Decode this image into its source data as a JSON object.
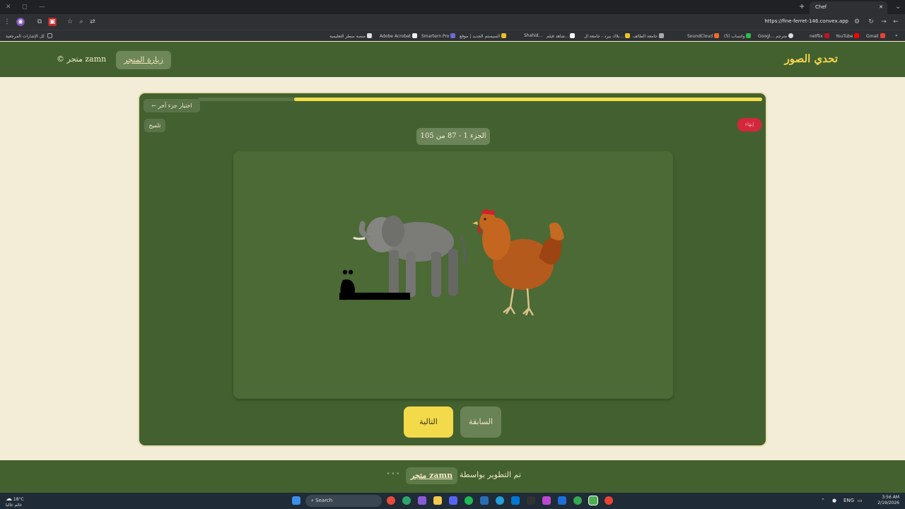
{
  "browser": {
    "tab_title": "Chef",
    "url": "https://fine-ferret-146.convex.app",
    "bookmarks_all": "كل الإشارات المرجعية",
    "bookmarks": [
      "منصة سطر التعليمية",
      "Adobe Acrobat",
      "Smartern Pro",
      "السيستم الجديد | موقع",
      "Shahid...",
      "شاهد فيلم...",
      "بلاك بيرد - جامعة ال...",
      "جامعة الطائف",
      "SoundCloud",
      "(5) واتساب",
      "Googl... مترجم",
      "netflix",
      "YouTube",
      "Gmail"
    ]
  },
  "header": {
    "brand": "تحدي الصور",
    "visit_store": "زيارة المتجر",
    "copyright": "© متجر zamn"
  },
  "game": {
    "back_label": "← اختيار جزء آخر",
    "hint_label": "تلميح",
    "red_label": "إنهاء",
    "counter": "الجزء 1 - 87 من 105",
    "progress_fraction": 0.83,
    "image_text": "ـة",
    "images": [
      "elephant-image",
      "chicken-image"
    ],
    "next_label": "التالية",
    "prev_label": "السابقة"
  },
  "footer": {
    "credit_text": "تم التطوير بواسطة",
    "store_link": "متجر zamn",
    "dots": "•••"
  },
  "taskbar": {
    "weather_temp": "18°C",
    "weather_desc": "غائم غالبا",
    "search_placeholder": "Search",
    "lang": "ENG",
    "time": "3:56 AM",
    "date": "2/19/2026"
  },
  "colors": {
    "header_green": "#43612e",
    "accent_yellow": "#f3da4b",
    "page_bg": "#f3ecd7",
    "alert_red": "#d2273c"
  }
}
